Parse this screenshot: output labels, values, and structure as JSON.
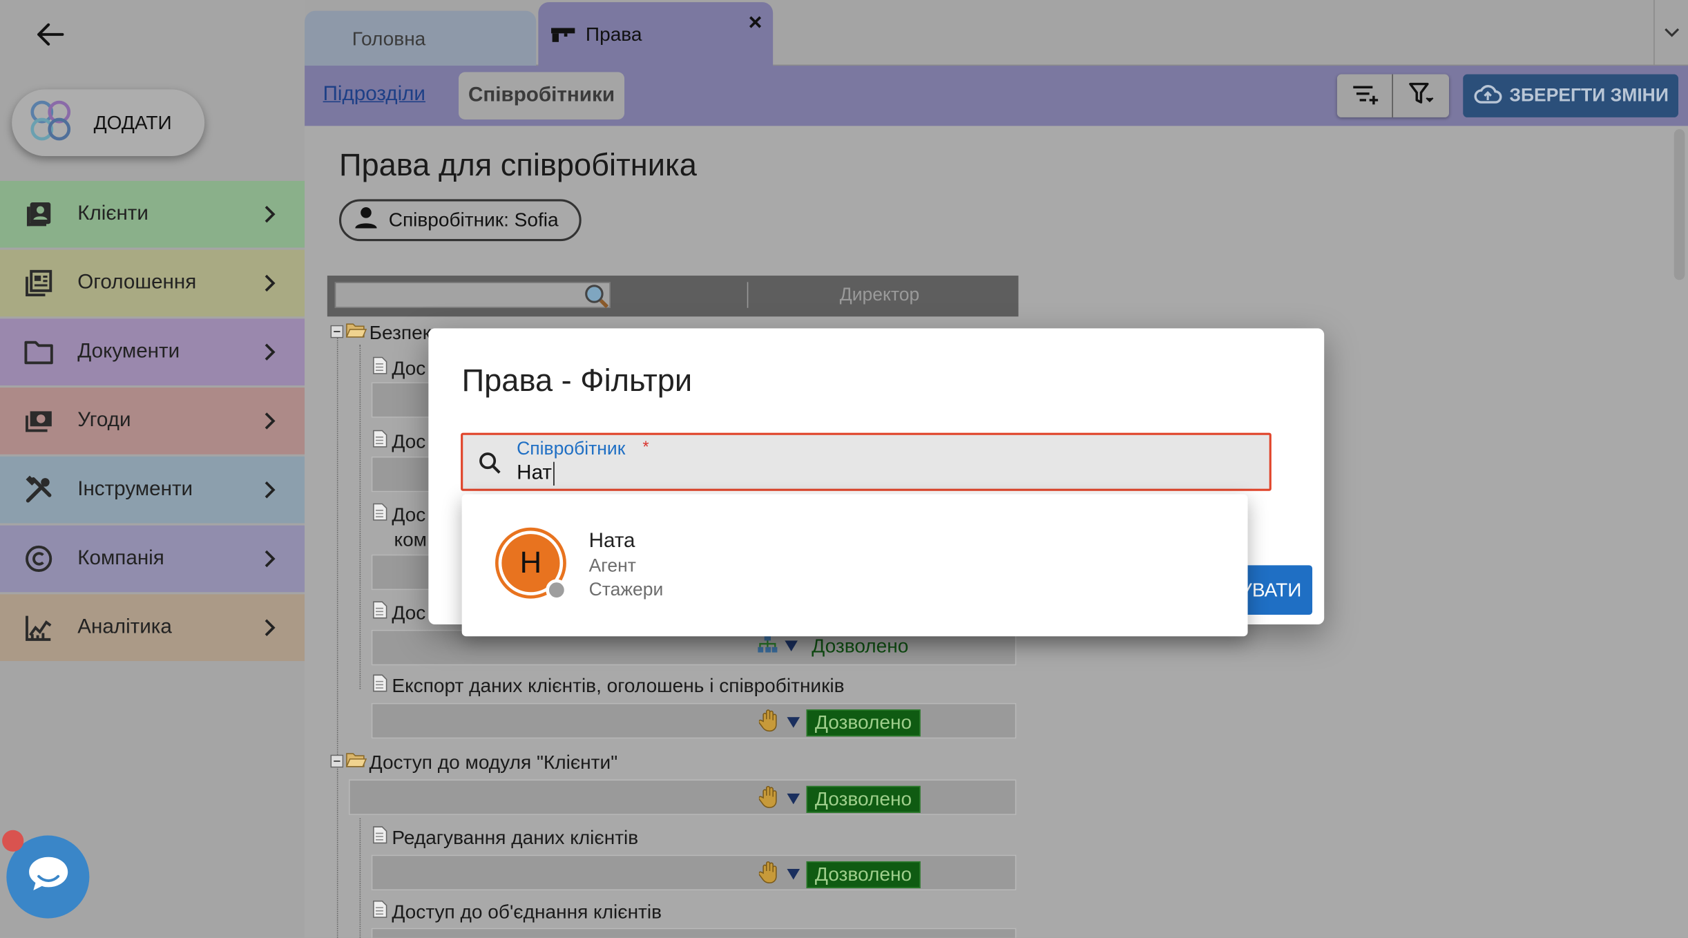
{
  "sidebar": {
    "add_label": "ДОДАТИ",
    "items": [
      {
        "label": "Клієнти",
        "icon": "contacts-icon",
        "color": "#8ab08a"
      },
      {
        "label": "Оголошення",
        "icon": "listing-icon",
        "color": "#a9aa83"
      },
      {
        "label": "Документи",
        "icon": "folder-icon",
        "color": "#9a88ad"
      },
      {
        "label": "Угоди",
        "icon": "money-icon",
        "color": "#ad8a88"
      },
      {
        "label": "Інструменти",
        "icon": "tools-icon",
        "color": "#8c9fad"
      },
      {
        "label": "Компанія",
        "icon": "copyright-icon",
        "color": "#918dad"
      },
      {
        "label": "Аналітика",
        "icon": "analytics-icon",
        "color": "#ab9a87"
      }
    ]
  },
  "tabs": [
    {
      "label": "Головна"
    },
    {
      "label": "Права",
      "close": "×"
    }
  ],
  "subnav": {
    "link": "Підрозділи",
    "active": "Співробітники",
    "save": "ЗБЕРЕГТИ ЗМІНИ"
  },
  "page": {
    "title": "Права для співробітника",
    "chip": "Співробітник: Sofia"
  },
  "tree": {
    "column": "Директор",
    "rows": [
      {
        "label": "Безпек"
      },
      {
        "label": "Дос"
      },
      {
        "label": "Дос"
      },
      {
        "label": "Дос"
      },
      {
        "label": "ком"
      },
      {
        "label": "Дос"
      },
      {
        "label": "Експорт даних клієнтів, оголошень і співробітників"
      },
      {
        "label": "Доступ до модуля \"Клієнти\""
      },
      {
        "label": "Редагування даних клієнтів"
      },
      {
        "label": "Доступ до об'єднання клієнтів"
      }
    ],
    "perm": "Дозволено"
  },
  "modal": {
    "title": "Права - Фільтри",
    "field_label": "Співробітник",
    "required_mark": "*",
    "field_value": "Нат",
    "button_partial": "УВАТИ"
  },
  "suggestion": {
    "initial": "Н",
    "name": "Ната",
    "role": "Агент",
    "group": "Стажери",
    "avatar_color": "#e8731f"
  }
}
